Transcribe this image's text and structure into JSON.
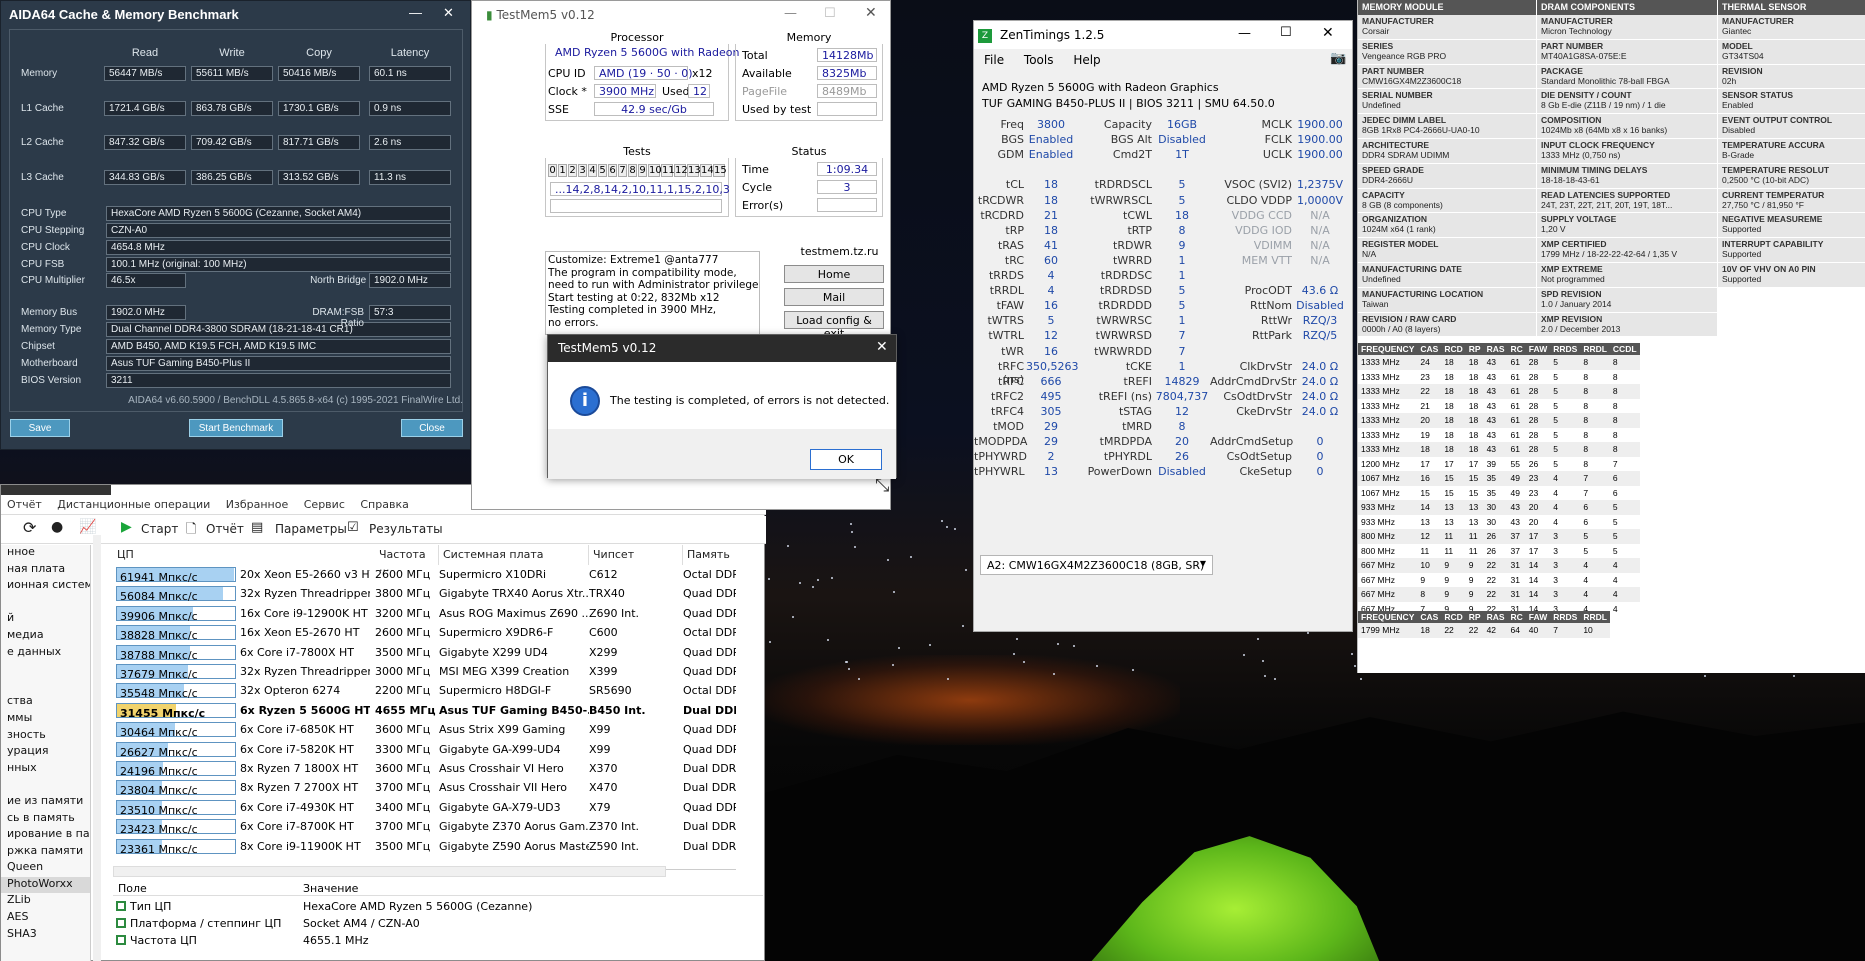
{
  "aida": {
    "title": "AIDA64 Cache & Memory Benchmark",
    "headers": [
      "Read",
      "Write",
      "Copy",
      "Latency"
    ],
    "rows": [
      {
        "label": "Memory",
        "read": "56447 MB/s",
        "write": "55611 MB/s",
        "copy": "50416 MB/s",
        "latency": "60.1 ns"
      },
      {
        "label": "L1 Cache",
        "read": "1721.4 GB/s",
        "write": "863.78 GB/s",
        "copy": "1730.1 GB/s",
        "latency": "0.9 ns"
      },
      {
        "label": "L2 Cache",
        "read": "847.32 GB/s",
        "write": "709.42 GB/s",
        "copy": "817.71 GB/s",
        "latency": "2.6 ns"
      },
      {
        "label": "L3 Cache",
        "read": "344.83 GB/s",
        "write": "386.25 GB/s",
        "copy": "313.52 GB/s",
        "latency": "11.3 ns"
      }
    ],
    "info": {
      "cpu_type_l": "CPU Type",
      "cpu_type": "HexaCore AMD Ryzen 5 5600G  (Cezanne, Socket AM4)",
      "cpu_step_l": "CPU Stepping",
      "cpu_step": "CZN-A0",
      "cpu_clock_l": "CPU Clock",
      "cpu_clock": "4654.8 MHz",
      "cpu_fsb_l": "CPU FSB",
      "cpu_fsb": "100.1 MHz  (original: 100 MHz)",
      "cpu_mult_l": "CPU Multiplier",
      "cpu_mult": "46.5x",
      "nb_clock_l": "North Bridge Clock",
      "nb_clock": "1902.0 MHz",
      "mem_bus_l": "Memory Bus",
      "mem_bus": "1902.0 MHz",
      "ratio_l": "DRAM:FSB Ratio",
      "ratio": "57:3",
      "mem_type_l": "Memory Type",
      "mem_type": "Dual Channel DDR4-3800 SDRAM  (18-21-18-41 CR1)",
      "chipset_l": "Chipset",
      "chipset": "AMD B450, AMD K19.5 FCH, AMD K19.5 IMC",
      "mobo_l": "Motherboard",
      "mobo": "Asus TUF Gaming B450-Plus II",
      "bios_l": "BIOS Version",
      "bios": "3211"
    },
    "footer": "AIDA64 v6.60.5900 / BenchDLL 4.5.865.8-x64  (c) 1995-2021 FinalWire Ltd.",
    "save": "Save",
    "start": "Start Benchmark",
    "close": "Close"
  },
  "rbench": {
    "menu": [
      "Отчёт",
      "Дистанционные операции",
      "Избранное",
      "Сервис",
      "Справка"
    ],
    "toolbar": {
      "start": "Старт",
      "report": "Отчёт",
      "params": "Параметры",
      "results": "Результаты"
    },
    "side": [
      "нное",
      "ная плата",
      "ионная систем",
      "",
      "й",
      "медиа",
      "е данных",
      "",
      "",
      "ства",
      "ммы",
      "зность",
      "урация",
      "нных",
      "",
      "ие из памяти",
      "сь в память",
      "ирование в пам",
      "ржка памяти",
      "Queen",
      "PhotoWorxx",
      "ZLib",
      "AES",
      "SHA3"
    ],
    "headers": [
      "ЦП",
      "Частота ...",
      "Системная плата",
      "Чипсет",
      "Память"
    ],
    "rows": [
      {
        "v": "61941 Мпкс/с",
        "f": 0.99,
        "cpu": "20x Xeon E5-2660 v3 HT",
        "fr": "2600 МГц",
        "mb": "Supermicro X10DRi",
        "cs": "C612",
        "mem": "Octal DDR4"
      },
      {
        "v": "56084 Мпкс/с",
        "f": 0.9,
        "cpu": "32x Ryzen Threadripper ...",
        "fr": "3800 МГц",
        "mb": "Gigabyte TRX40 Aorus Xtr...",
        "cs": "TRX40",
        "mem": "Quad DDR4"
      },
      {
        "v": "39906 Мпкс/с",
        "f": 0.64,
        "cpu": "16x Core i9-12900K HT",
        "fr": "3200 МГц",
        "mb": "Asus ROG Maximus Z690 ...",
        "cs": "Z690 Int.",
        "mem": "Quad DDR5"
      },
      {
        "v": "38828 Мпкс/с",
        "f": 0.62,
        "cpu": "16x Xeon E5-2670 HT",
        "fr": "2600 МГц",
        "mb": "Supermicro X9DR6-F",
        "cs": "C600",
        "mem": "Octal DDR3"
      },
      {
        "v": "38788 Мпкс/с",
        "f": 0.62,
        "cpu": "6x Core i7-7800X HT",
        "fr": "3500 МГц",
        "mb": "Gigabyte X299 UD4",
        "cs": "X299",
        "mem": "Quad DDR4"
      },
      {
        "v": "37679 Мпкс/с",
        "f": 0.6,
        "cpu": "32x Ryzen Threadripper ...",
        "fr": "3000 МГц",
        "mb": "MSI MEG X399 Creation",
        "cs": "X399",
        "mem": "Quad DDR4"
      },
      {
        "v": "35548 Мпкс/с",
        "f": 0.57,
        "cpu": "32x Opteron 6274",
        "fr": "2200 МГц",
        "mb": "Supermicro H8DGI-F",
        "cs": "SR5690",
        "mem": "Octal DDR3"
      },
      {
        "v": "31455 Мпкс/с",
        "f": 0.5,
        "cpu": "6x Ryzen 5 5600G HT",
        "fr": "4655 МГц",
        "mb": "Asus TUF Gaming B450-...",
        "cs": "B450 Int.",
        "mem": "Dual DDR4",
        "hl": true
      },
      {
        "v": "30464 Мпкс/с",
        "f": 0.49,
        "cpu": "6x Core i7-6850K HT",
        "fr": "3600 МГц",
        "mb": "Asus Strix X99 Gaming",
        "cs": "X99",
        "mem": "Quad DDR4"
      },
      {
        "v": "26627 Мпкс/с",
        "f": 0.43,
        "cpu": "6x Core i7-5820K HT",
        "fr": "3300 МГц",
        "mb": "Gigabyte GA-X99-UD4",
        "cs": "X99",
        "mem": "Quad DDR4"
      },
      {
        "v": "24196 Мпкс/с",
        "f": 0.39,
        "cpu": "8x Ryzen 7 1800X HT",
        "fr": "3600 МГц",
        "mb": "Asus Crosshair VI Hero",
        "cs": "X370",
        "mem": "Dual DDR4"
      },
      {
        "v": "23804 Мпкс/с",
        "f": 0.38,
        "cpu": "8x Ryzen 7 2700X HT",
        "fr": "3700 МГц",
        "mb": "Asus Crosshair VII Hero",
        "cs": "X470",
        "mem": "Dual DDR4"
      },
      {
        "v": "23510 Мпкс/с",
        "f": 0.38,
        "cpu": "6x Core i7-4930K HT",
        "fr": "3400 МГц",
        "mb": "Gigabyte GA-X79-UD3",
        "cs": "X79",
        "mem": "Quad DDR3"
      },
      {
        "v": "23423 Мпкс/с",
        "f": 0.38,
        "cpu": "6x Core i7-8700K HT",
        "fr": "3700 МГц",
        "mb": "Gigabyte Z370 Aorus Gam...",
        "cs": "Z370 Int.",
        "mem": "Dual DDR4"
      },
      {
        "v": "23361 Мпкс/с",
        "f": 0.38,
        "cpu": "8x Core i9-11900K HT",
        "fr": "3500 МГц",
        "mb": "Gigabyte Z590 Aorus Master",
        "cs": "Z590 Int.",
        "mem": "Dual DDR4"
      }
    ],
    "info_headers": [
      "Поле",
      "Значение"
    ],
    "info": [
      {
        "k": "Тип ЦП",
        "v": "HexaCore AMD Ryzen 5 5600G  (Cezanne)"
      },
      {
        "k": "Платформа / степпинг ЦП",
        "v": "Socket AM4 / CZN-A0"
      },
      {
        "k": "Частота ЦП",
        "v": "4655.1 MHz"
      }
    ]
  },
  "testmem": {
    "title": "TestMem5 v0.12",
    "processor_l": "Processor",
    "processor": "AMD Ryzen 5 5600G with Radeon",
    "cpuid_l": "CPU ID",
    "cpuid": "AMD  (19 · 50 · 0)",
    "threads": "x12",
    "clock_l": "Clock *",
    "clock": "3900 MHz",
    "used_l": "Used",
    "used": "12",
    "sse_l": "SSE",
    "sse": "42.9 sec/Gb",
    "memory_l": "Memory",
    "total_l": "Total",
    "total": "14128Mb",
    "avail_l": "Available",
    "avail": "8325Mb",
    "pagefile_l": "PageFile",
    "pagefile": "8489Mb",
    "usedtest_l": "Used by test",
    "tests_l": "Tests",
    "test_nums": [
      "0",
      "1",
      "2",
      "3",
      "4",
      "5",
      "6",
      "7",
      "8",
      "9",
      "10",
      "11",
      "12",
      "13",
      "14",
      "15"
    ],
    "seq": "...14,2,8,14,2,10,11,1,15,2,10,3",
    "status_l": "Status",
    "time_l": "Time",
    "time": "1:09.34",
    "cycle_l": "Cycle",
    "cycle": "3",
    "err_l": "Error(s)",
    "log": [
      "Customize: Extreme1 @anta777",
      "The program in compatibility mode,",
      "need to run with Administrator privileges!",
      "Start testing at 0:22, 832Mb x12",
      "Testing completed in 3900 MHz,",
      "no errors."
    ],
    "site": "testmem.tz.ru",
    "home": "Home",
    "mail": "Mail",
    "load": "Load config & exit"
  },
  "dialog": {
    "title": "TestMem5 v0.12",
    "msg": "The testing is completed, of errors is not detected.",
    "ok": "OK"
  },
  "zen": {
    "title": "ZenTimings 1.2.5",
    "menu": [
      "File",
      "Tools",
      "Help"
    ],
    "cpu": "AMD Ryzen 5 5600G with Radeon Graphics",
    "board": "TUF GAMING B450-PLUS II | BIOS 3211 | SMU 64.50.0",
    "c1": [
      [
        "Freq",
        "3800"
      ],
      [
        "BGS",
        "Enabled"
      ],
      [
        "GDM",
        "Enabled"
      ],
      [
        "",
        ""
      ],
      [
        "tCL",
        "18"
      ],
      [
        "tRCDWR",
        "18"
      ],
      [
        "tRCDRD",
        "21"
      ],
      [
        "tRP",
        "18"
      ],
      [
        "tRAS",
        "41"
      ],
      [
        "tRC",
        "60"
      ],
      [
        "tRRDS",
        "4"
      ],
      [
        "tRRDL",
        "4"
      ],
      [
        "tFAW",
        "16"
      ],
      [
        "tWTRS",
        "5"
      ],
      [
        "tWTRL",
        "12"
      ],
      [
        "tWR",
        "16"
      ],
      [
        "tRFC (ns)",
        "350,5263"
      ],
      [
        "tRFC",
        "666"
      ],
      [
        "tRFC2",
        "495"
      ],
      [
        "tRFC4",
        "305"
      ],
      [
        "tMOD",
        "29"
      ],
      [
        "tMODPDA",
        "29"
      ],
      [
        "tPHYWRD",
        "2"
      ],
      [
        "tPHYWRL",
        "13"
      ]
    ],
    "c2": [
      [
        "Capacity",
        "16GB"
      ],
      [
        "BGS Alt",
        "Disabled"
      ],
      [
        "Cmd2T",
        "1T"
      ],
      [
        "",
        ""
      ],
      [
        "tRDRDSCL",
        "5"
      ],
      [
        "tWRWRSCL",
        "5"
      ],
      [
        "tCWL",
        "18"
      ],
      [
        "tRTP",
        "8"
      ],
      [
        "tRDWR",
        "9"
      ],
      [
        "tWRRD",
        "1"
      ],
      [
        "tRDRDSC",
        "1"
      ],
      [
        "tRDRDSD",
        "5"
      ],
      [
        "tRDRDDD",
        "5"
      ],
      [
        "tWRWRSC",
        "1"
      ],
      [
        "tWRWRSD",
        "7"
      ],
      [
        "tWRWRDD",
        "7"
      ],
      [
        "tCKE",
        "1"
      ],
      [
        "tREFI",
        "14829"
      ],
      [
        "tREFI (ns)",
        "7804,737"
      ],
      [
        "tSTAG",
        "12"
      ],
      [
        "tMRD",
        "8"
      ],
      [
        "tMRDPDA",
        "20"
      ],
      [
        "tPHYRDL",
        "26"
      ],
      [
        "PowerDown",
        "Disabled"
      ]
    ],
    "c3": [
      [
        "MCLK",
        "1900.00"
      ],
      [
        "FCLK",
        "1900.00"
      ],
      [
        "UCLK",
        "1900.00"
      ],
      [
        "",
        ""
      ],
      [
        "VSOC (SVI2)",
        "1,2375V"
      ],
      [
        "CLDO VDDP",
        "1,0000V"
      ],
      [
        "VDDG CCD",
        "N/A"
      ],
      [
        "VDDG IOD",
        "N/A"
      ],
      [
        "VDIMM",
        "N/A"
      ],
      [
        "MEM VTT",
        "N/A"
      ],
      [
        "",
        ""
      ],
      [
        "ProcODT",
        "43.6 Ω"
      ],
      [
        "RttNom",
        "Disabled"
      ],
      [
        "RttWr",
        "RZQ/3"
      ],
      [
        "RttPark",
        "RZQ/5"
      ],
      [
        "",
        ""
      ],
      [
        "ClkDrvStr",
        "24.0 Ω"
      ],
      [
        "AddrCmdDrvStr",
        "24.0 Ω"
      ],
      [
        "CsOdtDrvStr",
        "24.0 Ω"
      ],
      [
        "CkeDrvStr",
        "24.0 Ω"
      ],
      [
        "",
        ""
      ],
      [
        "AddrCmdSetup",
        "0"
      ],
      [
        "CsOdtSetup",
        "0"
      ],
      [
        "CkeSetup",
        "0"
      ]
    ],
    "dimm": "A2: CMW16GX4M2Z3600C18 (8GB, SR)"
  },
  "spd": {
    "h1": "MEMORY MODULE",
    "h2": "DRAM COMPONENTS",
    "h3": "THERMAL SENSOR",
    "c1": [
      [
        "MANUFACTURER",
        "Corsair"
      ],
      [
        "SERIES",
        "Vengeance RGB PRO"
      ],
      [
        "PART NUMBER",
        "CMW16GX4M2Z3600C18"
      ],
      [
        "SERIAL NUMBER",
        "Undefined"
      ],
      [
        "JEDEC DIMM LABEL",
        "8GB 1Rx8 PC4-2666U-UA0-10"
      ],
      [
        "ARCHITECTURE",
        "DDR4 SDRAM UDIMM"
      ],
      [
        "SPEED GRADE",
        "DDR4-2666U"
      ],
      [
        "CAPACITY",
        "8 GB (8 components)"
      ],
      [
        "ORGANIZATION",
        "1024M x64 (1 rank)"
      ],
      [
        "REGISTER MODEL",
        "N/A"
      ],
      [
        "MANUFACTURING DATE",
        "Undefined"
      ],
      [
        "MANUFACTURING LOCATION",
        "Taiwan"
      ],
      [
        "REVISION / RAW CARD",
        "0000h / A0 (8 layers)"
      ]
    ],
    "c2": [
      [
        "MANUFACTURER",
        "Micron Technology"
      ],
      [
        "PART NUMBER",
        "MT40A1G8SA-075E:E"
      ],
      [
        "PACKAGE",
        "Standard Monolithic 78-ball FBGA"
      ],
      [
        "DIE DENSITY / COUNT",
        "8 Gb E-die (Z11B / 19 nm) / 1 die"
      ],
      [
        "COMPOSITION",
        "1024Mb x8 (64Mb x8 x 16 banks)"
      ],
      [
        "INPUT CLOCK FREQUENCY",
        "1333 MHz (0,750 ns)"
      ],
      [
        "MINIMUM TIMING DELAYS",
        "18-18-18-43-61"
      ],
      [
        "READ LATENCIES SUPPORTED",
        "24T, 23T, 22T, 21T, 20T, 19T, 18T..."
      ],
      [
        "SUPPLY VOLTAGE",
        "1,20 V"
      ],
      [
        "XMP CERTIFIED",
        "1799 MHz / 18-22-22-42-64 / 1,35 V"
      ],
      [
        "XMP EXTREME",
        "Not programmed"
      ],
      [
        "SPD REVISION",
        "1.0 / January 2014"
      ],
      [
        "XMP REVISION",
        "2.0 / December 2013"
      ]
    ],
    "c3": [
      [
        "MANUFACTURER",
        "Giantec"
      ],
      [
        "MODEL",
        "GT34TS04"
      ],
      [
        "REVISION",
        "02h"
      ],
      [
        "SENSOR STATUS",
        "Enabled"
      ],
      [
        "EVENT OUTPUT CONTROL",
        "Disabled"
      ],
      [
        "TEMPERATURE ACCURA",
        "B-Grade"
      ],
      [
        "TEMPERATURE RESOLUT",
        "0,2500 °C (10-bit ADC)"
      ],
      [
        "CURRENT TEMPERATUR",
        "27,750 °C / 81,950 °F"
      ],
      [
        "NEGATIVE MEASUREME",
        "Supported"
      ],
      [
        "INTERRUPT CAPABILITY",
        "Supported"
      ],
      [
        "10V OF VHV ON A0 PIN",
        "Supported"
      ]
    ],
    "th": [
      "FREQUENCY",
      "CAS",
      "RCD",
      "RP",
      "RAS",
      "RC",
      "FAW",
      "RRDS",
      "RRDL",
      "CCDL"
    ],
    "rows": [
      [
        "1333 MHz",
        "24",
        "18",
        "18",
        "43",
        "61",
        "28",
        "5",
        "8",
        "8"
      ],
      [
        "1333 MHz",
        "23",
        "18",
        "18",
        "43",
        "61",
        "28",
        "5",
        "8",
        "8"
      ],
      [
        "1333 MHz",
        "22",
        "18",
        "18",
        "43",
        "61",
        "28",
        "5",
        "8",
        "8"
      ],
      [
        "1333 MHz",
        "21",
        "18",
        "18",
        "43",
        "61",
        "28",
        "5",
        "8",
        "8"
      ],
      [
        "1333 MHz",
        "20",
        "18",
        "18",
        "43",
        "61",
        "28",
        "5",
        "8",
        "8"
      ],
      [
        "1333 MHz",
        "19",
        "18",
        "18",
        "43",
        "61",
        "28",
        "5",
        "8",
        "8"
      ],
      [
        "1333 MHz",
        "18",
        "18",
        "18",
        "43",
        "61",
        "28",
        "5",
        "8",
        "8"
      ],
      [
        "1200 MHz",
        "17",
        "17",
        "17",
        "39",
        "55",
        "26",
        "5",
        "8",
        "7"
      ],
      [
        "1067 MHz",
        "16",
        "15",
        "15",
        "35",
        "49",
        "23",
        "4",
        "7",
        "6"
      ],
      [
        "1067 MHz",
        "15",
        "15",
        "15",
        "35",
        "49",
        "23",
        "4",
        "7",
        "6"
      ],
      [
        "933 MHz",
        "14",
        "13",
        "13",
        "30",
        "43",
        "20",
        "4",
        "6",
        "5"
      ],
      [
        "933 MHz",
        "13",
        "13",
        "13",
        "30",
        "43",
        "20",
        "4",
        "6",
        "5"
      ],
      [
        "800 MHz",
        "12",
        "11",
        "11",
        "26",
        "37",
        "17",
        "3",
        "5",
        "5"
      ],
      [
        "800 MHz",
        "11",
        "11",
        "11",
        "26",
        "37",
        "17",
        "3",
        "5",
        "5"
      ],
      [
        "667 MHz",
        "10",
        "9",
        "9",
        "22",
        "31",
        "14",
        "3",
        "4",
        "4"
      ],
      [
        "667 MHz",
        "9",
        "9",
        "9",
        "22",
        "31",
        "14",
        "3",
        "4",
        "4"
      ],
      [
        "667 MHz",
        "8",
        "9",
        "9",
        "22",
        "31",
        "14",
        "3",
        "4",
        "4"
      ],
      [
        "667 MHz",
        "7",
        "9",
        "9",
        "22",
        "31",
        "14",
        "3",
        "4",
        "4"
      ]
    ],
    "th2": [
      "FREQUENCY",
      "CAS",
      "RCD",
      "RP",
      "RAS",
      "RC",
      "FAW",
      "RRDS",
      "RRDL"
    ],
    "xmp": [
      "1799 MHz",
      "18",
      "22",
      "22",
      "42",
      "64",
      "40",
      "7",
      "10"
    ]
  }
}
